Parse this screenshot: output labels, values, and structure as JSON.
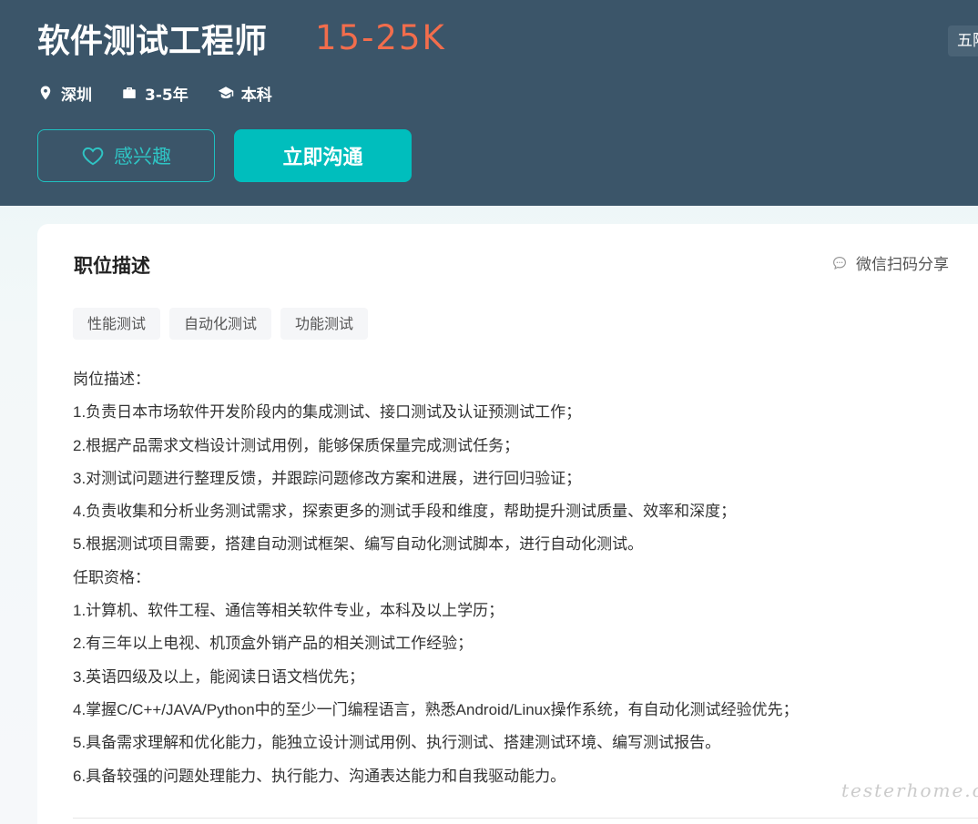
{
  "header": {
    "title": "软件测试工程师",
    "salary": "15-25K",
    "corner_tag": "五险",
    "meta": [
      {
        "icon": "location-pin-icon",
        "text": "深圳"
      },
      {
        "icon": "briefcase-icon",
        "text": "3-5年"
      },
      {
        "icon": "graduation-cap-icon",
        "text": "本科"
      }
    ],
    "interest_label": "感兴趣",
    "chat_label": "立即沟通"
  },
  "card": {
    "section_title": "职位描述",
    "share_label": "微信扫码分享",
    "tags": [
      "性能测试",
      "自动化测试",
      "功能测试"
    ],
    "lines": [
      "岗位描述：",
      "1.负责日本市场软件开发阶段内的集成测试、接口测试及认证预测试工作；",
      "2.根据产品需求文档设计测试用例，能够保质保量完成测试任务；",
      "3.对测试问题进行整理反馈，并跟踪问题修改方案和进展，进行回归验证；",
      "4.负责收集和分析业务测试需求，探索更多的测试手段和维度，帮助提升测试质量、效率和深度；",
      "5.根据测试项目需要，搭建自动测试框架、编写自动化测试脚本，进行自动化测试。",
      "任职资格：",
      "1.计算机、软件工程、通信等相关软件专业，本科及以上学历；",
      "2.有三年以上电视、机顶盒外销产品的相关测试工作经验；",
      "3.英语四级及以上，能阅读日语文档优先；",
      "4.掌握C/C++/JAVA/Python中的至少一门编程语言，熟悉Android/Linux操作系统，有自动化测试经验优先；",
      "5.具备需求理解和优化能力，能独立设计测试用例、执行测试、搭建测试环境、编写测试报告。",
      "6.具备较强的问题处理能力、执行能力、沟通表达能力和自我驱动能力。"
    ]
  },
  "watermark": "testerhome.com",
  "colors": {
    "header_bg": "#3b5569",
    "salary": "#f26d4c",
    "accent": "#00bebd"
  }
}
